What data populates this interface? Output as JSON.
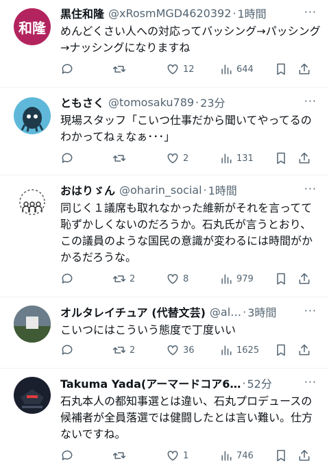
{
  "tweets": [
    {
      "name": "黒住和隆",
      "handle": "@xRosmMGD4620392",
      "time": "1時間",
      "avatar_text": "和隆",
      "avatar_color": "#b3245f",
      "text": "めんどくさい人への対応ってバッシング→パッシング→ナッシングになりますね",
      "replies": "",
      "retweets": "",
      "likes": "12",
      "views": "644"
    },
    {
      "name": "ともさく",
      "handle": "@tomosaku789",
      "time": "23分",
      "text": "現場スタッフ「こいつ仕事だから聞いてやってるのわかってねぇなぁ･･･」",
      "replies": "",
      "retweets": "",
      "likes": "2",
      "views": "131"
    },
    {
      "name": "おはりゞん",
      "handle": "@oharin_social",
      "time": "1時間",
      "text": "同じく１議席も取れなかった維新がそれを言ってて恥ずかしくないのだろうか。石丸氏が言うとおり、この議員のような国民の意識が変わるには時間がかかるだろうな。",
      "replies": "",
      "retweets": "2",
      "likes": "8",
      "views": "979"
    },
    {
      "name": "オルタレイチュア (代替文芸)",
      "handle": "@al…",
      "time": "3時間",
      "text": "こいつにはこういう態度で丁度いい",
      "replies": "",
      "retweets": "2",
      "likes": "36",
      "views": "1625"
    },
    {
      "name": "Takuma Yada(アーマードコア6…",
      "handle": "",
      "time": "52分",
      "text": "石丸本人の都知事選とは違い、石丸プロデュースの候補者が全員落選では健闘したとは言い難い。仕方ないですね。",
      "replies": "",
      "retweets": "",
      "likes": "1",
      "views": "746"
    }
  ],
  "more_label": "···",
  "dot": "·"
}
